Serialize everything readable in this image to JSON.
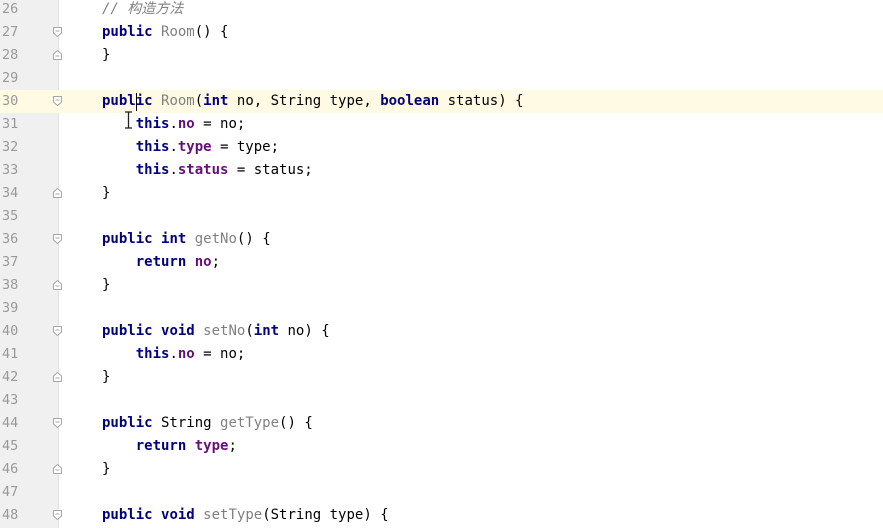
{
  "editor": {
    "caret_line": "30",
    "lines": [
      {
        "no": "26",
        "fold": "",
        "current": false,
        "tokens": [
          {
            "t": "cmt",
            "s": "// 构造方法"
          }
        ]
      },
      {
        "no": "27",
        "fold": "open",
        "current": false,
        "tokens": [
          {
            "t": "kw",
            "s": "public"
          },
          {
            "t": "txt",
            "s": " "
          },
          {
            "t": "fn",
            "s": "Room"
          },
          {
            "t": "txt",
            "s": "() {"
          }
        ]
      },
      {
        "no": "28",
        "fold": "close",
        "current": false,
        "tokens": [
          {
            "t": "txt",
            "s": "}"
          }
        ]
      },
      {
        "no": "29",
        "fold": "",
        "current": false,
        "tokens": []
      },
      {
        "no": "30",
        "fold": "open",
        "current": true,
        "tokens": [
          {
            "t": "kw",
            "s": "public"
          },
          {
            "t": "txt",
            "s": " "
          },
          {
            "t": "fn",
            "s": "Room"
          },
          {
            "t": "txt",
            "s": "("
          },
          {
            "t": "kw",
            "s": "int"
          },
          {
            "t": "txt",
            "s": " no, String type, "
          },
          {
            "t": "kw",
            "s": "boolean"
          },
          {
            "t": "txt",
            "s": " status) {"
          }
        ]
      },
      {
        "no": "31",
        "fold": "",
        "current": false,
        "tokens": [
          {
            "t": "txt",
            "s": "    "
          },
          {
            "t": "kw",
            "s": "this"
          },
          {
            "t": "txt",
            "s": "."
          },
          {
            "t": "fld",
            "s": "no"
          },
          {
            "t": "txt",
            "s": " = no;"
          }
        ]
      },
      {
        "no": "32",
        "fold": "",
        "current": false,
        "tokens": [
          {
            "t": "txt",
            "s": "    "
          },
          {
            "t": "kw",
            "s": "this"
          },
          {
            "t": "txt",
            "s": "."
          },
          {
            "t": "fld",
            "s": "type"
          },
          {
            "t": "txt",
            "s": " = type;"
          }
        ]
      },
      {
        "no": "33",
        "fold": "",
        "current": false,
        "tokens": [
          {
            "t": "txt",
            "s": "    "
          },
          {
            "t": "kw",
            "s": "this"
          },
          {
            "t": "txt",
            "s": "."
          },
          {
            "t": "fld",
            "s": "status"
          },
          {
            "t": "txt",
            "s": " = status;"
          }
        ]
      },
      {
        "no": "34",
        "fold": "close",
        "current": false,
        "tokens": [
          {
            "t": "txt",
            "s": "}"
          }
        ]
      },
      {
        "no": "35",
        "fold": "",
        "current": false,
        "tokens": []
      },
      {
        "no": "36",
        "fold": "open",
        "current": false,
        "tokens": [
          {
            "t": "kw",
            "s": "public"
          },
          {
            "t": "txt",
            "s": " "
          },
          {
            "t": "kw",
            "s": "int"
          },
          {
            "t": "txt",
            "s": " "
          },
          {
            "t": "fn",
            "s": "getNo"
          },
          {
            "t": "txt",
            "s": "() {"
          }
        ]
      },
      {
        "no": "37",
        "fold": "",
        "current": false,
        "tokens": [
          {
            "t": "txt",
            "s": "    "
          },
          {
            "t": "kw",
            "s": "return"
          },
          {
            "t": "txt",
            "s": " "
          },
          {
            "t": "fld",
            "s": "no"
          },
          {
            "t": "txt",
            "s": ";"
          }
        ]
      },
      {
        "no": "38",
        "fold": "close",
        "current": false,
        "tokens": [
          {
            "t": "txt",
            "s": "}"
          }
        ]
      },
      {
        "no": "39",
        "fold": "",
        "current": false,
        "tokens": []
      },
      {
        "no": "40",
        "fold": "open",
        "current": false,
        "tokens": [
          {
            "t": "kw",
            "s": "public"
          },
          {
            "t": "txt",
            "s": " "
          },
          {
            "t": "kw",
            "s": "void"
          },
          {
            "t": "txt",
            "s": " "
          },
          {
            "t": "fn",
            "s": "setNo"
          },
          {
            "t": "txt",
            "s": "("
          },
          {
            "t": "kw",
            "s": "int"
          },
          {
            "t": "txt",
            "s": " no) {"
          }
        ]
      },
      {
        "no": "41",
        "fold": "",
        "current": false,
        "tokens": [
          {
            "t": "txt",
            "s": "    "
          },
          {
            "t": "kw",
            "s": "this"
          },
          {
            "t": "txt",
            "s": "."
          },
          {
            "t": "fld",
            "s": "no"
          },
          {
            "t": "txt",
            "s": " = no;"
          }
        ]
      },
      {
        "no": "42",
        "fold": "close",
        "current": false,
        "tokens": [
          {
            "t": "txt",
            "s": "}"
          }
        ]
      },
      {
        "no": "43",
        "fold": "",
        "current": false,
        "tokens": []
      },
      {
        "no": "44",
        "fold": "open",
        "current": false,
        "tokens": [
          {
            "t": "kw",
            "s": "public"
          },
          {
            "t": "txt",
            "s": " String "
          },
          {
            "t": "fn",
            "s": "getType"
          },
          {
            "t": "txt",
            "s": "() {"
          }
        ]
      },
      {
        "no": "45",
        "fold": "",
        "current": false,
        "tokens": [
          {
            "t": "txt",
            "s": "    "
          },
          {
            "t": "kw",
            "s": "return"
          },
          {
            "t": "txt",
            "s": " "
          },
          {
            "t": "fld",
            "s": "type"
          },
          {
            "t": "txt",
            "s": ";"
          }
        ]
      },
      {
        "no": "46",
        "fold": "close",
        "current": false,
        "tokens": [
          {
            "t": "txt",
            "s": "}"
          }
        ]
      },
      {
        "no": "47",
        "fold": "",
        "current": false,
        "tokens": []
      },
      {
        "no": "48",
        "fold": "open",
        "current": false,
        "tokens": [
          {
            "t": "kw",
            "s": "public"
          },
          {
            "t": "txt",
            "s": " "
          },
          {
            "t": "kw",
            "s": "void"
          },
          {
            "t": "txt",
            "s": " "
          },
          {
            "t": "fn",
            "s": "setType"
          },
          {
            "t": "txt",
            "s": "(String type) {"
          }
        ]
      }
    ]
  },
  "colors": {
    "keyword": "#000080",
    "field": "#660e7a",
    "method_name": "#808080",
    "comment": "#808080",
    "current_line": "#fffae3",
    "gutter": "#f0f0f0"
  },
  "icons": {
    "fold_open": "fold-open-icon",
    "fold_close": "fold-close-icon",
    "cursor": "text-cursor-icon"
  }
}
